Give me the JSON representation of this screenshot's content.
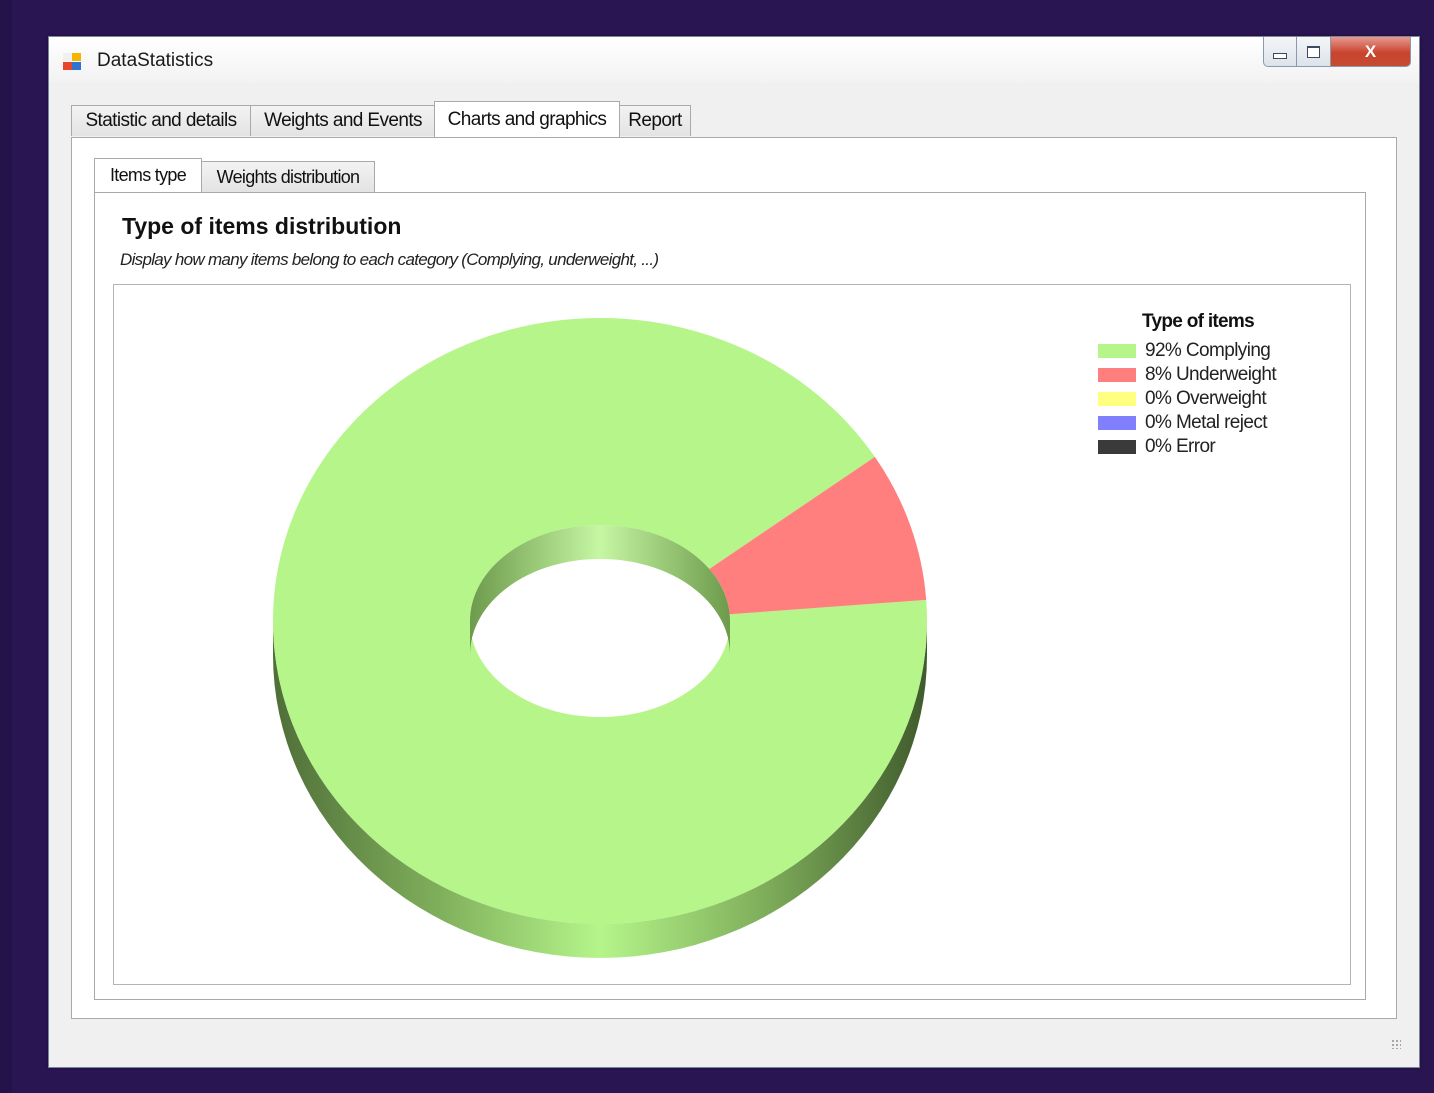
{
  "window": {
    "title": "DataStatistics"
  },
  "caption_buttons": {
    "close_label": "X"
  },
  "main_tabs": [
    {
      "label": "Statistic and details",
      "active": false
    },
    {
      "label": "Weights and Events",
      "active": false
    },
    {
      "label": "Charts and graphics",
      "active": true
    },
    {
      "label": "Report",
      "active": false
    }
  ],
  "sub_tabs": [
    {
      "label": "Items type",
      "active": true
    },
    {
      "label": "Weights distribution",
      "active": false
    }
  ],
  "chart": {
    "title": "Type of items distribution",
    "subtitle": "Display how many items belong to each category (Complying, underweight, ...)",
    "legend_title": "Type of items"
  },
  "chart_data": {
    "type": "pie",
    "style": "3d-doughnut",
    "title": "Type of items distribution",
    "legend_title": "Type of items",
    "legend_position": "top-right",
    "slices": [
      {
        "label": "92% Complying",
        "name": "Complying",
        "value": 92,
        "color": "#b5f58a"
      },
      {
        "label": "8% Underweight",
        "name": "Underweight",
        "value": 8,
        "color": "#ff7f7f"
      },
      {
        "label": "0% Overweight",
        "name": "Overweight",
        "value": 0,
        "color": "#ffff80"
      },
      {
        "label": "0% Metal reject",
        "name": "Metal reject",
        "value": 0,
        "color": "#8080ff"
      },
      {
        "label": "0% Error",
        "name": "Error",
        "value": 0,
        "color": "#3a3a3a"
      }
    ]
  }
}
